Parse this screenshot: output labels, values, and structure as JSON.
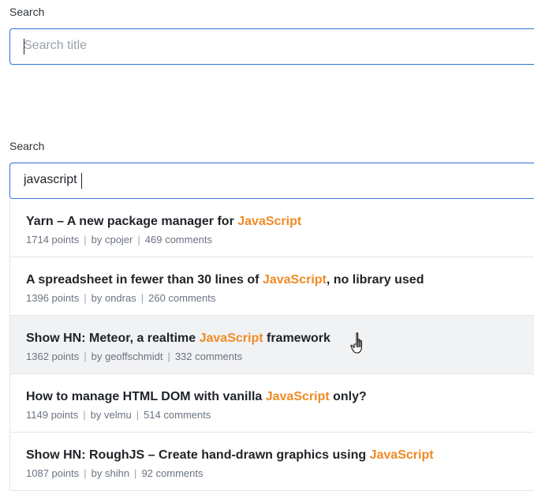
{
  "search_empty": {
    "label": "Search",
    "placeholder": "Search title",
    "value": ""
  },
  "search_active": {
    "label": "Search",
    "value": "javascript"
  },
  "highlight_color": "#f08a24",
  "accent_color": "#3c78d8",
  "results": [
    {
      "title_before": "Yarn – A new package manager for ",
      "title_highlight": "JavaScript",
      "title_after": "",
      "points": "1714 points",
      "author": "by cpojer",
      "comments": "469 comments"
    },
    {
      "title_before": "A spreadsheet in fewer than 30 lines of ",
      "title_highlight": "JavaScript",
      "title_after": ", no library used",
      "points": "1396 points",
      "author": "by ondras",
      "comments": "260 comments"
    },
    {
      "title_before": "Show HN: Meteor, a realtime ",
      "title_highlight": "JavaScript",
      "title_after": " framework",
      "points": "1362 points",
      "author": "by geoffschmidt",
      "comments": "332 comments"
    },
    {
      "title_before": "How to manage HTML DOM with vanilla ",
      "title_highlight": "JavaScript",
      "title_after": " only?",
      "points": "1149 points",
      "author": "by velmu",
      "comments": "514 comments"
    },
    {
      "title_before": "Show HN: RoughJS – Create hand-drawn graphics using ",
      "title_highlight": "JavaScript",
      "title_after": "",
      "points": "1087 points",
      "author": "by shihn",
      "comments": "92 comments"
    }
  ],
  "meta_separator": "|",
  "cursor_icon": "hand-pointer-icon"
}
